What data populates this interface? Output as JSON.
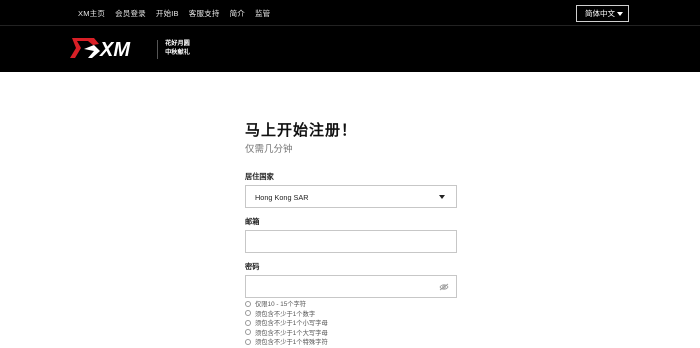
{
  "topbar": {
    "nav": [
      "XM主页",
      "会员登录",
      "开始IB",
      "客服支持",
      "简介",
      "监管"
    ],
    "language": "简体中文"
  },
  "header": {
    "logo_text": "XM",
    "promo_line1": "花好月圆",
    "promo_line2": "中秋献礼"
  },
  "form": {
    "title": "马上开始注册！",
    "subtitle": "仅需几分钟",
    "country_label": "居住国家",
    "country_value": "Hong Kong SAR",
    "email_label": "邮箱",
    "email_value": "",
    "password_label": "密码",
    "password_value": "",
    "rules": [
      "仅限10 - 15个字符",
      "须包含不少于1个数字",
      "须包含不少于1个小写字母",
      "须包含不少于1个大写字母",
      "须包含不少于1个特殊字符"
    ]
  },
  "colors": {
    "black": "#000000",
    "red": "#d81f26",
    "white": "#ffffff"
  }
}
